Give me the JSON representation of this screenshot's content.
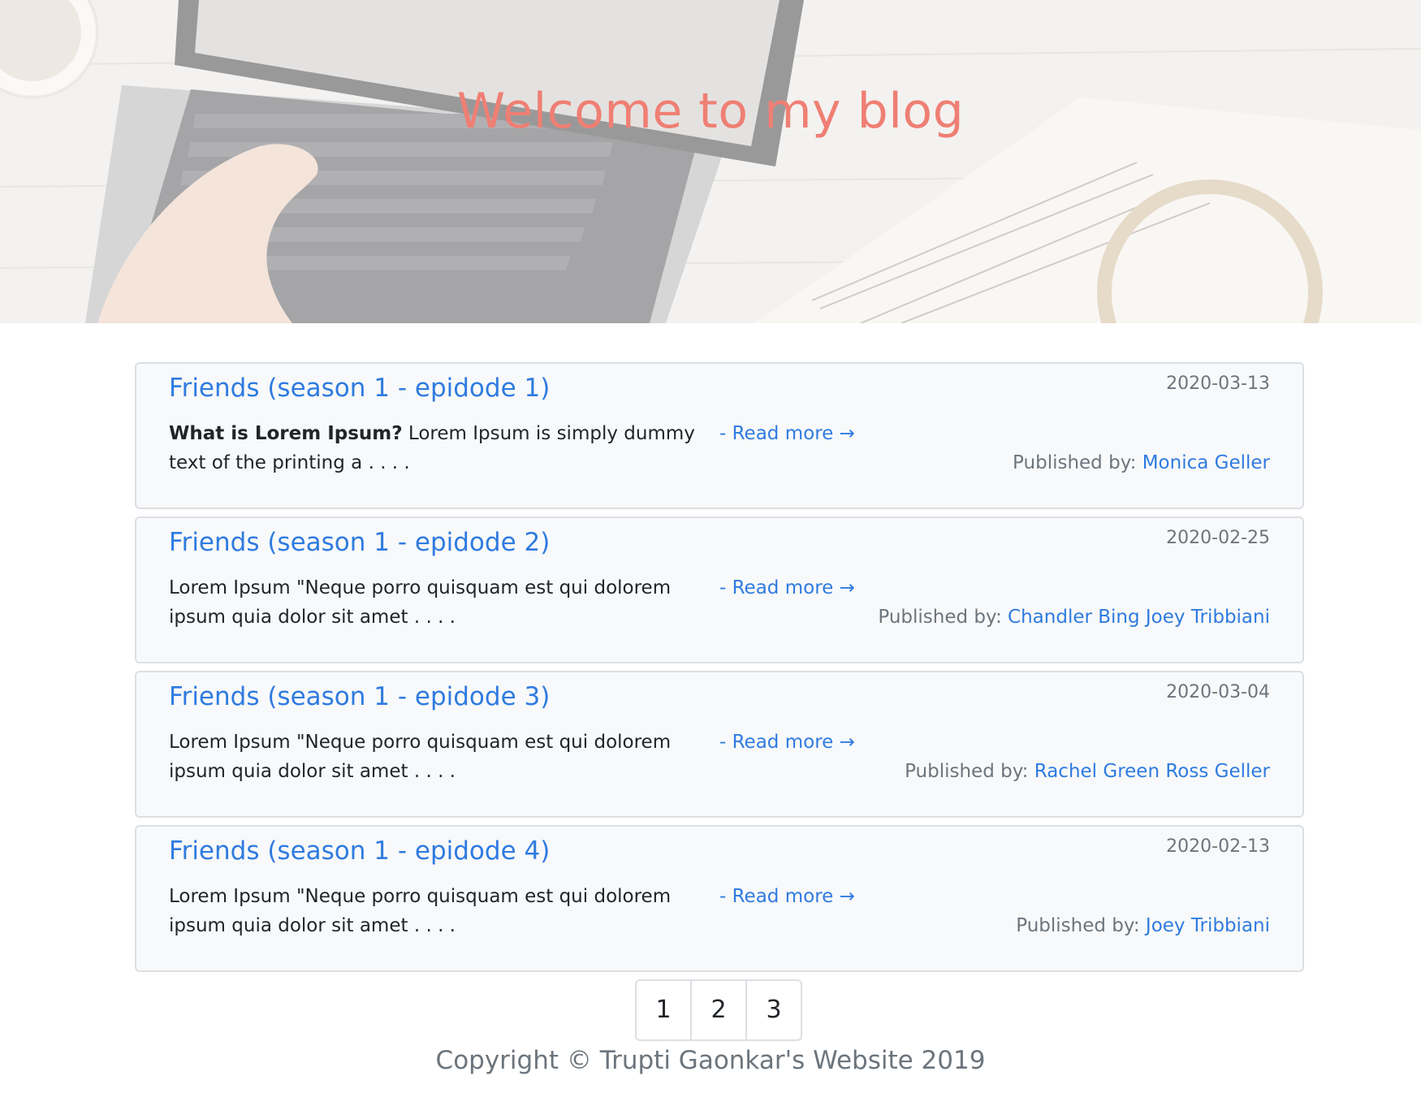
{
  "hero": {
    "title": "Welcome to my blog"
  },
  "posts": [
    {
      "title": "Friends (season 1 - epidode 1)",
      "date": "2020-03-13",
      "excerpt_bold": "What is Lorem Ipsum?",
      "excerpt": " Lorem Ipsum is simply dummy text of the printing a . . . .",
      "read_more": "- Read more →",
      "published_by_label": "Published by: ",
      "authors": "Monica Geller"
    },
    {
      "title": "Friends (season 1 - epidode 2)",
      "date": "2020-02-25",
      "excerpt_bold": "",
      "excerpt": "Lorem Ipsum \"Neque porro quisquam est qui dolorem ipsum quia dolor sit amet . . . .",
      "read_more": "- Read more →",
      "published_by_label": "Published by: ",
      "authors": "Chandler Bing Joey Tribbiani"
    },
    {
      "title": "Friends (season 1 - epidode 3)",
      "date": "2020-03-04",
      "excerpt_bold": "",
      "excerpt": "Lorem Ipsum \"Neque porro quisquam est qui dolorem ipsum quia dolor sit amet . . . .",
      "read_more": "- Read more →",
      "published_by_label": "Published by: ",
      "authors": "Rachel Green Ross Geller"
    },
    {
      "title": "Friends (season 1 - epidode 4)",
      "date": "2020-02-13",
      "excerpt_bold": "",
      "excerpt": "Lorem Ipsum \"Neque porro quisquam est qui dolorem ipsum quia dolor sit amet . . . .",
      "read_more": "- Read more →",
      "published_by_label": "Published by: ",
      "authors": "Joey Tribbiani"
    }
  ],
  "pagination": {
    "pages": [
      "1",
      "2",
      "3"
    ]
  },
  "footer": {
    "copyright": "Copyright © Trupti Gaonkar's Website 2019"
  },
  "colors": {
    "hero_title": "#ef7f74",
    "link": "#2f7be0",
    "muted": "#6c757d",
    "card_bg": "#f8f9fa"
  }
}
